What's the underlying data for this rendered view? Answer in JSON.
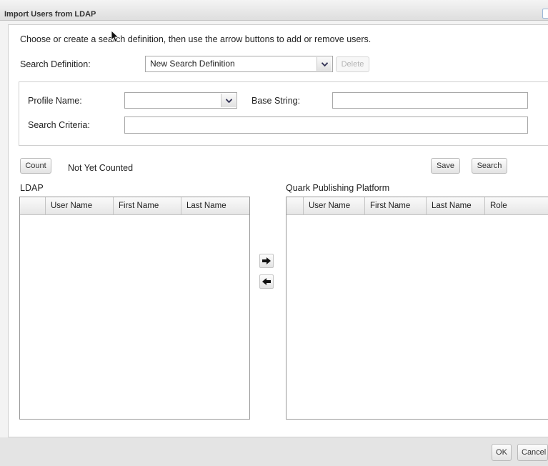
{
  "window": {
    "title": "Import Users from LDAP"
  },
  "instructions": "Choose or create a search definition, then use the arrow buttons to add or remove users.",
  "search_definition": {
    "label": "Search Definition:",
    "value": "New Search Definition",
    "delete_label": "Delete"
  },
  "profile": {
    "profile_name_label": "Profile Name:",
    "profile_name_value": "",
    "base_string_label": "Base String:",
    "base_string_value": "",
    "search_criteria_label": "Search Criteria:",
    "search_criteria_value": ""
  },
  "count": {
    "button_label": "Count",
    "status": "Not Yet Counted"
  },
  "actions": {
    "save_label": "Save",
    "search_label": "Search"
  },
  "ldap_grid": {
    "title": "LDAP",
    "columns": [
      "",
      "User Name",
      "First Name",
      "Last Name"
    ]
  },
  "qpp_grid": {
    "title": "Quark Publishing Platform",
    "columns": [
      "",
      "User Name",
      "First Name",
      "Last Name",
      "Role"
    ]
  },
  "footer": {
    "ok_label": "OK",
    "cancel_label": "Cancel"
  },
  "icons": {
    "add": "arrow-right-icon",
    "remove": "arrow-left-icon",
    "dropdown": "chevron-down-icon",
    "close": "close-icon",
    "cursor": "mouse-pointer-icon"
  }
}
